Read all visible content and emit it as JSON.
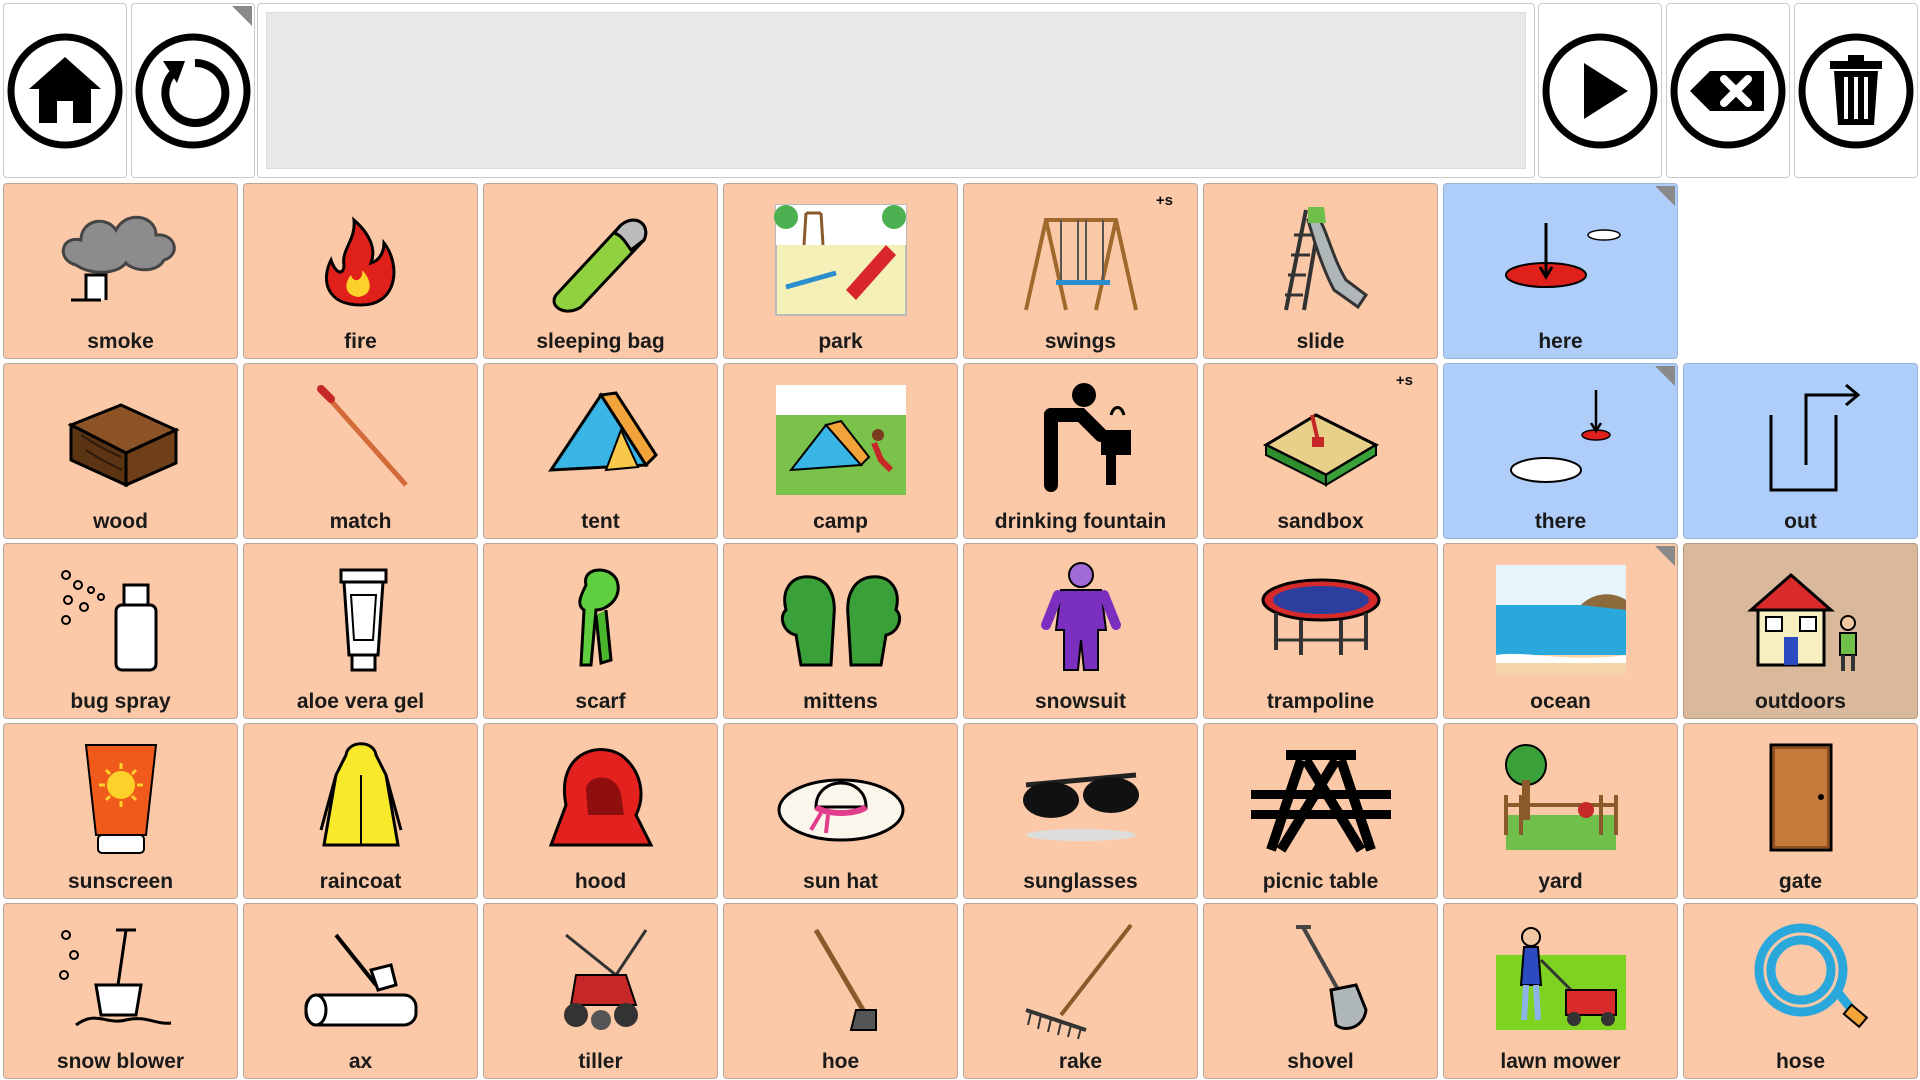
{
  "colors": {
    "tile": "#fbc9a7",
    "tile_blue": "#aecdf8",
    "tile_tan": "#d9b89b",
    "message_bar": "#e9e9e9"
  },
  "toolbar": {
    "home_icon": "home-icon",
    "back_icon": "undo-icon",
    "speak_icon": "play-icon",
    "backspace_icon": "backspace-icon",
    "clear_icon": "trash-icon"
  },
  "grid": {
    "rows": [
      [
        {
          "label": "smoke",
          "icon": "smoke-icon"
        },
        {
          "label": "fire",
          "icon": "fire-icon"
        },
        {
          "label": "sleeping bag",
          "icon": "sleeping-bag-icon"
        },
        {
          "label": "park",
          "icon": "park-icon"
        },
        {
          "label": "swings",
          "icon": "swings-icon",
          "badge": "+s"
        },
        {
          "label": "slide",
          "icon": "slide-icon"
        },
        {
          "label": "here",
          "icon": "here-icon",
          "color": "blue",
          "folder": true
        },
        {
          "label": "",
          "icon": "",
          "color": "empty"
        }
      ],
      [
        {
          "label": "wood",
          "icon": "wood-icon"
        },
        {
          "label": "match",
          "icon": "match-icon"
        },
        {
          "label": "tent",
          "icon": "tent-icon"
        },
        {
          "label": "camp",
          "icon": "camp-icon"
        },
        {
          "label": "drinking fountain",
          "icon": "drinking-fountain-icon"
        },
        {
          "label": "sandbox",
          "icon": "sandbox-icon",
          "badge": "+s"
        },
        {
          "label": "there",
          "icon": "there-icon",
          "color": "blue",
          "folder": true
        },
        {
          "label": "out",
          "icon": "out-icon",
          "color": "blue"
        }
      ],
      [
        {
          "label": "bug spray",
          "icon": "bug-spray-icon"
        },
        {
          "label": "aloe vera gel",
          "icon": "aloe-vera-gel-icon"
        },
        {
          "label": "scarf",
          "icon": "scarf-icon"
        },
        {
          "label": "mittens",
          "icon": "mittens-icon"
        },
        {
          "label": "snowsuit",
          "icon": "snowsuit-icon"
        },
        {
          "label": "trampoline",
          "icon": "trampoline-icon"
        },
        {
          "label": "ocean",
          "icon": "ocean-icon",
          "folder": true
        },
        {
          "label": "outdoors",
          "icon": "outdoors-icon",
          "color": "tan"
        }
      ],
      [
        {
          "label": "sunscreen",
          "icon": "sunscreen-icon"
        },
        {
          "label": "raincoat",
          "icon": "raincoat-icon"
        },
        {
          "label": "hood",
          "icon": "hood-icon"
        },
        {
          "label": "sun hat",
          "icon": "sun-hat-icon"
        },
        {
          "label": "sunglasses",
          "icon": "sunglasses-icon"
        },
        {
          "label": "picnic table",
          "icon": "picnic-table-icon"
        },
        {
          "label": "yard",
          "icon": "yard-icon"
        },
        {
          "label": "gate",
          "icon": "gate-icon"
        }
      ],
      [
        {
          "label": "snow blower",
          "icon": "snow-blower-icon"
        },
        {
          "label": "ax",
          "icon": "ax-icon"
        },
        {
          "label": "tiller",
          "icon": "tiller-icon"
        },
        {
          "label": "hoe",
          "icon": "hoe-icon"
        },
        {
          "label": "rake",
          "icon": "rake-icon"
        },
        {
          "label": "shovel",
          "icon": "shovel-icon"
        },
        {
          "label": "lawn mower",
          "icon": "lawn-mower-icon"
        },
        {
          "label": "hose",
          "icon": "hose-icon"
        }
      ]
    ]
  }
}
